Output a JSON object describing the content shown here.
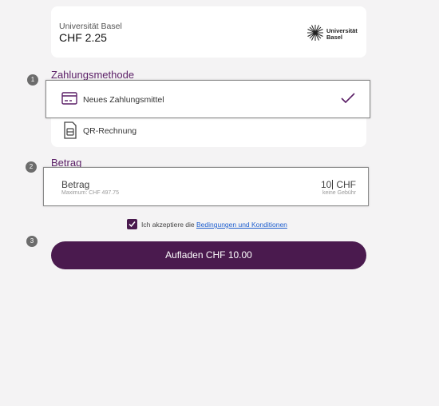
{
  "balance": {
    "institution": "Universität Basel",
    "amount": "CHF 2.25",
    "logo_text_line1": "Universität",
    "logo_text_line2": "Basel"
  },
  "steps": [
    "1",
    "2",
    "3"
  ],
  "payment": {
    "title": "Zahlungsmethode",
    "options": [
      {
        "label": "Neues Zahlungsmittel",
        "icon": "credit-card-icon",
        "selected": true
      },
      {
        "label": "QR-Rechnung",
        "icon": "qr-invoice-icon",
        "selected": false
      }
    ]
  },
  "amount": {
    "title": "Betrag",
    "field_label": "Betrag",
    "maximum": "Maximum: CHF 497.75",
    "value": "10",
    "currency": "CHF",
    "fee": "keine Gebühr"
  },
  "terms": {
    "prefix": "Ich akzeptiere die",
    "link": "Bedingungen und Konditionen",
    "checked": true
  },
  "submit_label": "Aufladen CHF 10.00",
  "colors": {
    "brand": "#4a1a4e",
    "title": "#5a1e66",
    "link": "#1f5fcf",
    "background": "#f4f3f4"
  }
}
